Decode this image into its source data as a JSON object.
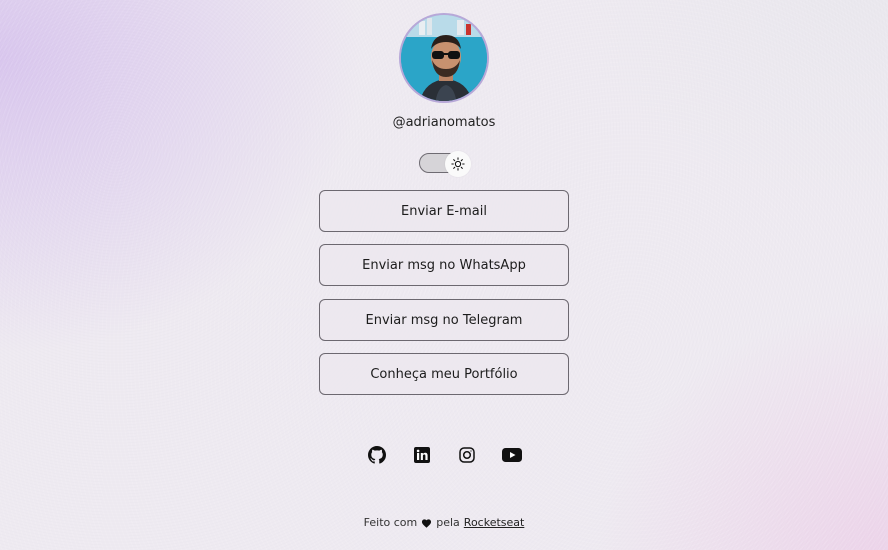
{
  "profile": {
    "username": "@adrianomatos"
  },
  "theme_toggle": {
    "icon": "sun-icon"
  },
  "links": [
    {
      "label": "Enviar E-mail"
    },
    {
      "label": "Enviar msg no WhatsApp"
    },
    {
      "label": "Enviar msg no Telegram"
    },
    {
      "label": "Conheça meu Portfólio"
    }
  ],
  "social": [
    {
      "icon": "github-icon"
    },
    {
      "icon": "linkedin-icon"
    },
    {
      "icon": "instagram-icon"
    },
    {
      "icon": "youtube-icon"
    }
  ],
  "footer": {
    "prefix": "Feito com",
    "heart_icon": "heart-icon",
    "middle": "pela",
    "link": "Rocketseat"
  },
  "colors": {
    "accent_border": "#b7a8d8",
    "button_border": "#6c6870"
  }
}
